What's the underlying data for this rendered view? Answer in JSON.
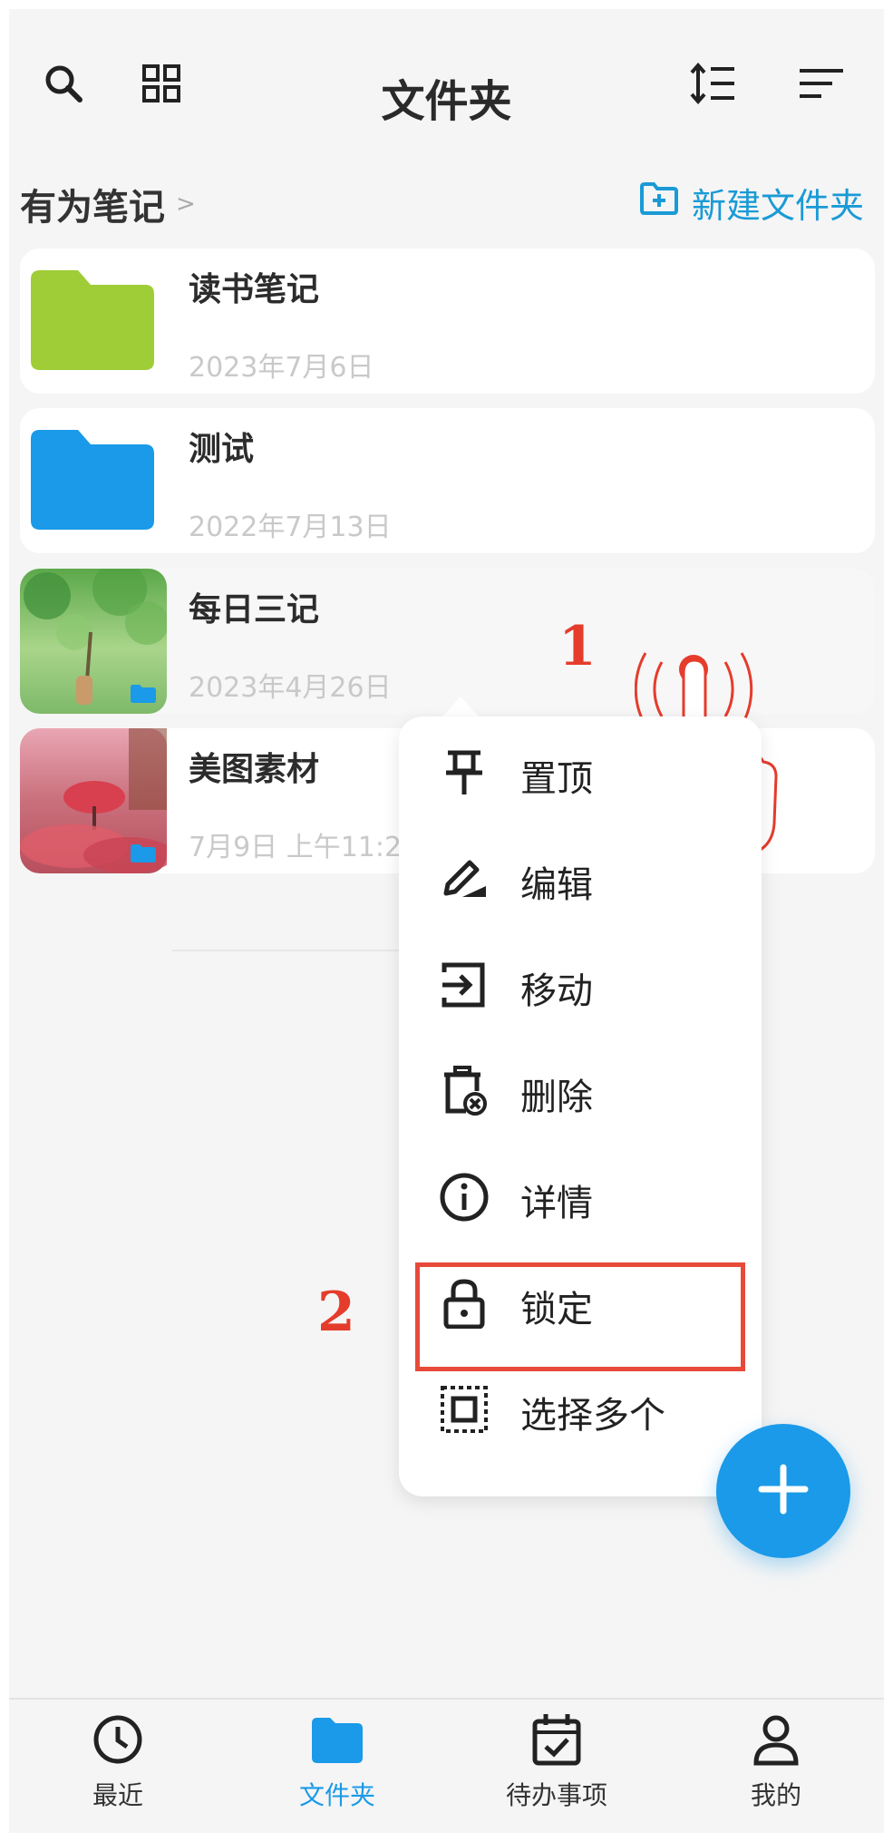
{
  "header": {
    "title": "文件夹",
    "search_icon": "search-icon",
    "grid_icon": "grid-view-icon",
    "sort_icon": "sort-order-icon",
    "filter_icon": "filter-lines-icon"
  },
  "breadcrumb": {
    "root": "有为笔记",
    "separator": ">"
  },
  "new_folder": {
    "label": "新建文件夹",
    "icon": "folder-add-icon"
  },
  "folders": [
    {
      "name": "读书笔记",
      "date": "2023年7月6日",
      "color": "#9fcd37",
      "thumb": "folder"
    },
    {
      "name": "测试",
      "date": "2022年7月13日",
      "color": "#1a9ae8",
      "thumb": "folder"
    },
    {
      "name": "每日三记",
      "date": "2023年4月26日",
      "thumb": "green-leaves-photo"
    },
    {
      "name": "美图素材",
      "date": "7月9日 上午11:2",
      "thumb": "pink-flower-photo"
    }
  ],
  "context_menu": {
    "items": [
      {
        "label": "置顶",
        "icon": "pin-icon"
      },
      {
        "label": "编辑",
        "icon": "edit-icon"
      },
      {
        "label": "移动",
        "icon": "move-icon"
      },
      {
        "label": "删除",
        "icon": "delete-icon"
      },
      {
        "label": "详情",
        "icon": "info-icon"
      },
      {
        "label": "锁定",
        "icon": "lock-icon"
      },
      {
        "label": "选择多个",
        "icon": "select-multiple-icon"
      }
    ]
  },
  "annotations": {
    "step1": "1",
    "step2": "2",
    "color": "#e53c2c"
  },
  "fab": {
    "icon": "plus-icon",
    "color": "#1a9ae8"
  },
  "bottom_nav": {
    "items": [
      {
        "label": "最近",
        "icon": "clock-icon",
        "active": false
      },
      {
        "label": "文件夹",
        "icon": "folder-icon",
        "active": true
      },
      {
        "label": "待办事项",
        "icon": "calendar-check-icon",
        "active": false
      },
      {
        "label": "我的",
        "icon": "user-icon",
        "active": false
      }
    ]
  }
}
